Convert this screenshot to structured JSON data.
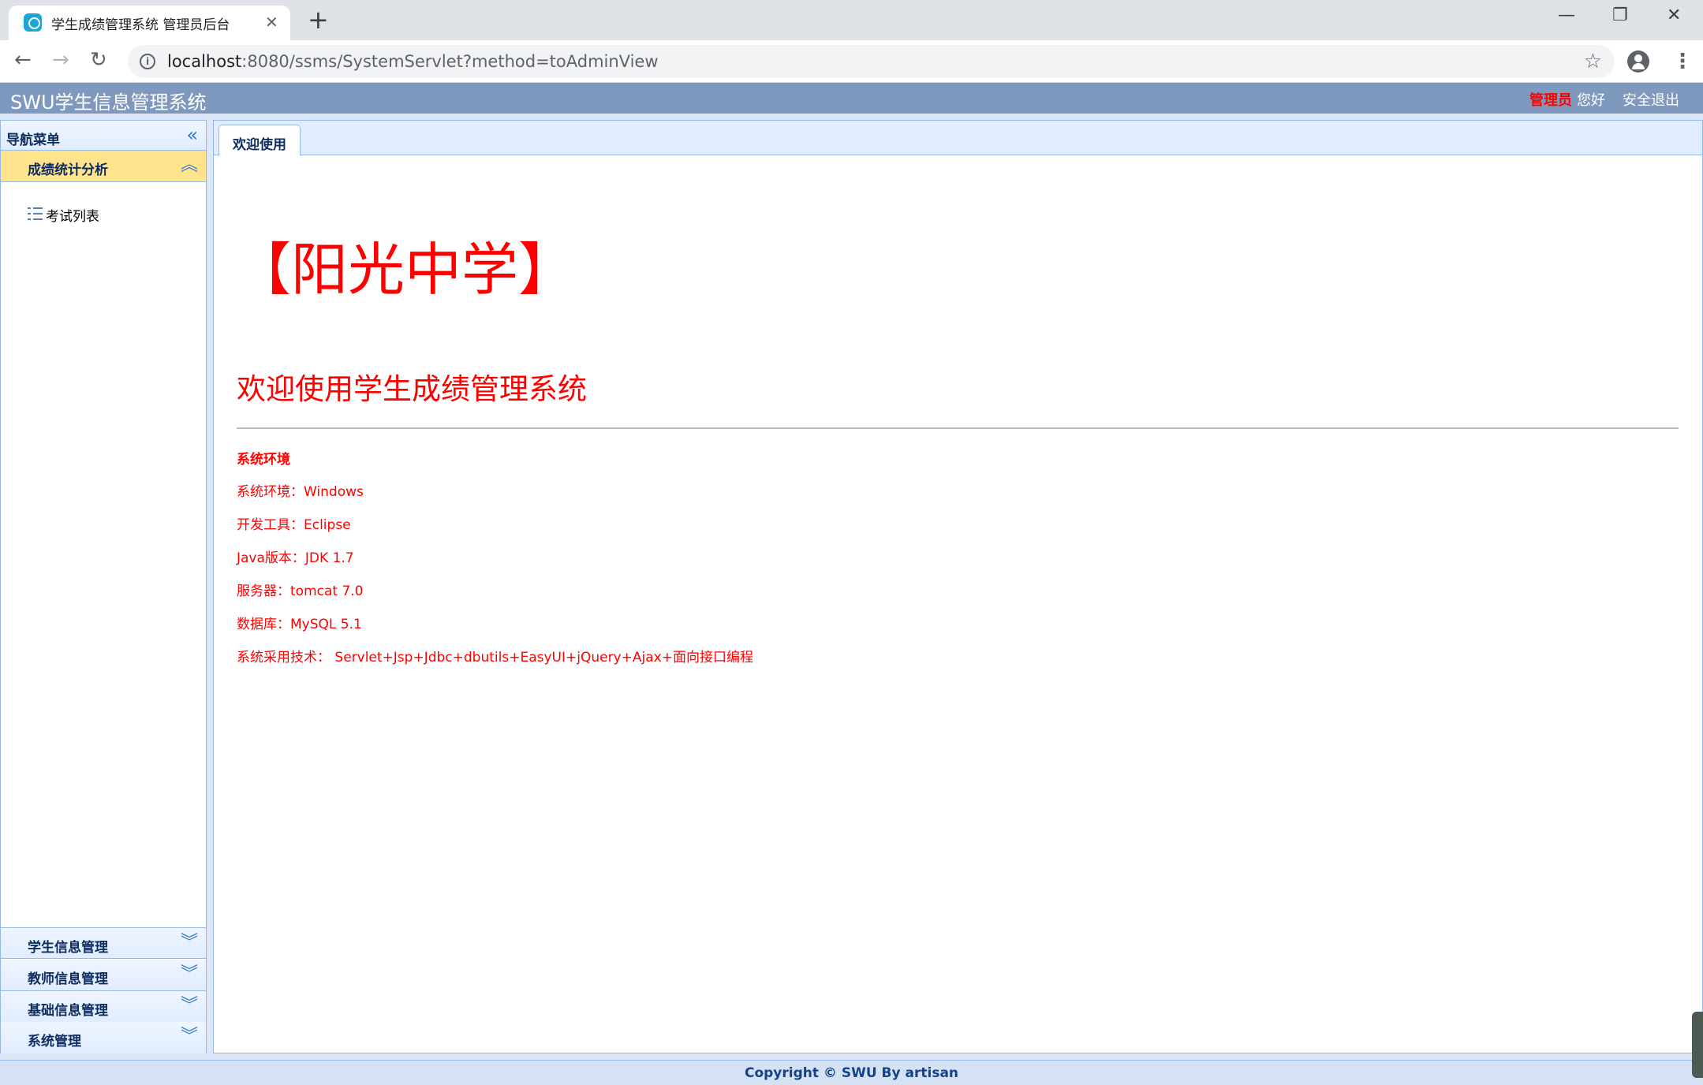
{
  "browser": {
    "tab_title": "学生成绩管理系统 管理员后台",
    "url_host": "localhost",
    "url_rest": ":8080/ssms/SystemServlet?method=toAdminView",
    "icons": {
      "back": "back-arrow-icon",
      "forward": "forward-arrow-icon",
      "reload": "reload-icon",
      "bookmark": "star-icon",
      "profile": "account-icon",
      "menu": "more-vert-icon"
    }
  },
  "header": {
    "title": "SWU学生信息管理系统",
    "role": "管理员",
    "greeting": "您好",
    "logout": "安全退出"
  },
  "nav": {
    "title": "导航菜单",
    "sections": [
      {
        "label": "成绩统计分析",
        "expanded": true,
        "items": [
          {
            "label": "考试列表"
          }
        ]
      },
      {
        "label": "学生信息管理",
        "expanded": false
      },
      {
        "label": "教师信息管理",
        "expanded": false
      },
      {
        "label": "基础信息管理",
        "expanded": false
      },
      {
        "label": "系统管理",
        "expanded": false
      }
    ]
  },
  "main": {
    "tabs": [
      {
        "label": "欢迎使用",
        "active": true
      }
    ],
    "school": "【阳光中学】",
    "welcome": "欢迎使用学生成绩管理系统",
    "env_title": "系统环境",
    "env_lines": [
      "系统环境：Windows",
      "开发工具：Eclipse",
      "Java版本：JDK 1.7",
      "服务器：tomcat 7.0",
      "数据库：MySQL 5.1",
      "系统采用技术： Servlet+Jsp+Jdbc+dbutils+EasyUI+jQuery+Ajax+面向接口编程"
    ]
  },
  "footer": {
    "copyright": "Copyright © SWU By artisan"
  },
  "colors": {
    "header_bg": "#7f99be",
    "accent_red": "#ff0000",
    "panel_border": "#95b8e7",
    "active_section": "#ffe48d"
  }
}
